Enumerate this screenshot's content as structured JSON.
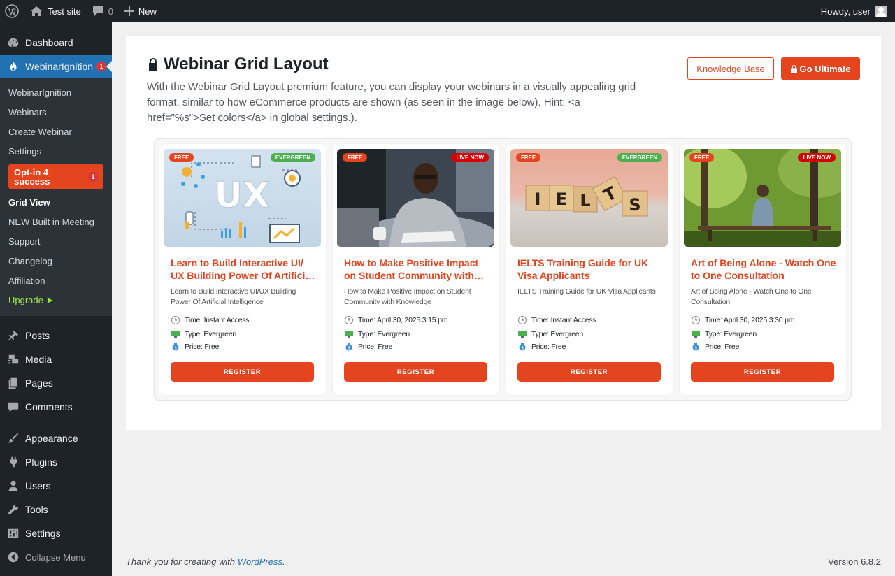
{
  "admin_bar": {
    "site_name": "Test site",
    "comment_count": "0",
    "new_label": "New",
    "howdy": "Howdy, user"
  },
  "sidebar": {
    "dashboard": "Dashboard",
    "plugin": "WebinarIgnition",
    "plugin_badge": "1",
    "submenu": {
      "webinarignition": "WebinarIgnition",
      "webinars": "Webinars",
      "create_webinar": "Create Webinar",
      "settings": "Settings",
      "optin_label": "Opt-in 4 success",
      "optin_badge": "1",
      "grid_view": "Grid View",
      "new_meeting": "NEW Built in Meeting",
      "support": "Support",
      "changelog": "Changelog",
      "affiliation": "Affiliation",
      "upgrade": "Upgrade ➤"
    },
    "posts": "Posts",
    "media": "Media",
    "pages": "Pages",
    "comments": "Comments",
    "appearance": "Appearance",
    "plugins": "Plugins",
    "users": "Users",
    "tools": "Tools",
    "settings": "Settings",
    "collapse": "Collapse Menu"
  },
  "page": {
    "title": "Webinar Grid Layout",
    "description": "With the Webinar Grid Layout premium feature, you can display your webinars in a visually appealing grid format, similar to how eCommerce products are shown (as seen in the image below). Hint: <a href=\"%s\">Set colors</a> in global settings.).",
    "knowledge_base": "Knowledge Base",
    "go_ultimate": "Go Ultimate"
  },
  "cards": [
    {
      "badge_left": "FREE",
      "badge_right": "EVERGREEN",
      "title": "Learn to Build Interactive UI/ UX Building Power Of Artificial Intelligence",
      "desc": "Learn to Build Interactive UI/UX Building Power Of Artificial Intelligence",
      "time": "Time: Instant Access",
      "type": "Type: Evergreen",
      "price": "Price: Free",
      "register": "REGISTER",
      "img_text": "UX"
    },
    {
      "badge_left": "FREE",
      "badge_right": "LIVE NOW",
      "title": "How to Make Positive Impact on Student Community with Knowledge",
      "desc": "How to Make Positive Impact on Student Community with Knowledge",
      "time": "Time: April 30, 2025 3:15 pm",
      "type": "Type: Evergreen",
      "price": "Price: Free",
      "register": "REGISTER"
    },
    {
      "badge_left": "FREE",
      "badge_right": "EVERGREEN",
      "title": "IELTS Training Guide for UK Visa Applicants",
      "desc": "IELTS Training Guide for UK Visa Applicants",
      "time": "Time: Instant Access",
      "type": "Type: Evergreen",
      "price": "Price: Free",
      "register": "REGISTER",
      "img_letters": [
        "I",
        "E",
        "L",
        "T",
        "S"
      ]
    },
    {
      "badge_left": "FREE",
      "badge_right": "LIVE NOW",
      "title": "Art of Being Alone - Watch One to One Consultation",
      "desc": "Art of Being Alone - Watch One to One Consultation",
      "time": "Time: April 30, 2025 3:30 pm",
      "type": "Type: Evergreen",
      "price": "Price: Free",
      "register": "REGISTER"
    }
  ],
  "footer": {
    "thanks_prefix": "Thank you for creating with ",
    "wordpress": "WordPress",
    "thanks_suffix": ".",
    "version": "Version 6.8.2"
  },
  "colors": {
    "accent": "#e4451f",
    "wp_blue": "#2271b1",
    "admin_dark": "#1d2327"
  }
}
